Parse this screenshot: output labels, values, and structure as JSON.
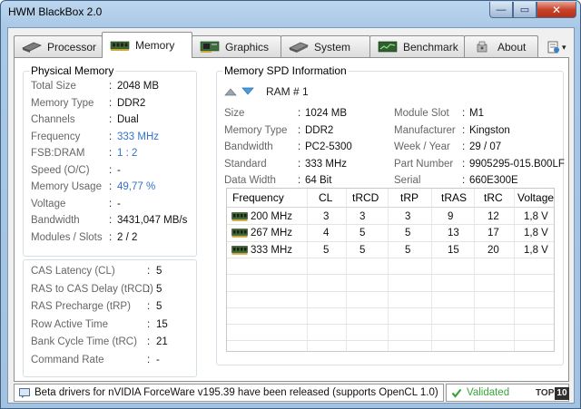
{
  "window": {
    "title": "HWM BlackBox 2.0",
    "min_glyph": "—",
    "max_glyph": "▭",
    "close_glyph": "✕"
  },
  "tabs": [
    {
      "label": "Processor",
      "icon": "cpu-icon"
    },
    {
      "label": "Memory",
      "icon": "memory-icon"
    },
    {
      "label": "Graphics",
      "icon": "graphics-card-icon"
    },
    {
      "label": "System",
      "icon": "system-icon"
    },
    {
      "label": "Benchmark",
      "icon": "benchmark-icon"
    },
    {
      "label": "About",
      "icon": "about-icon"
    }
  ],
  "menu_glyph": "▾",
  "physical_memory": {
    "title": "Physical Memory",
    "rows": [
      {
        "label": "Total Size",
        "value": "2048 MB"
      },
      {
        "label": "Memory Type",
        "value": "DDR2"
      },
      {
        "label": "Channels",
        "value": "Dual"
      },
      {
        "label": "Frequency",
        "value": "333 MHz"
      },
      {
        "label": "FSB:DRAM",
        "value": "1 : 2"
      },
      {
        "label": "Speed (O/C)",
        "value": "-"
      },
      {
        "label": "Memory Usage",
        "value": "49,77 %"
      },
      {
        "label": "Voltage",
        "value": "-"
      },
      {
        "label": "Bandwidth",
        "value": "3431,047 MB/s"
      },
      {
        "label": "Modules / Slots",
        "value": "2  /  2"
      }
    ]
  },
  "timings": {
    "rows": [
      {
        "label": "CAS Latency (CL)",
        "value": "5"
      },
      {
        "label": "RAS to CAS Delay (tRCD)",
        "value": "5"
      },
      {
        "label": "RAS Precharge (tRP)",
        "value": "5"
      },
      {
        "label": "Row Active Time",
        "value": "15"
      },
      {
        "label": "Bank Cycle Time (tRC)",
        "value": "21"
      },
      {
        "label": "Command Rate",
        "value": "-"
      }
    ]
  },
  "spd": {
    "title": "Memory SPD Information",
    "module": "RAM # 1",
    "left": [
      {
        "label": "Size",
        "value": "1024 MB"
      },
      {
        "label": "Memory Type",
        "value": "DDR2"
      },
      {
        "label": "Bandwidth",
        "value": "PC2-5300"
      },
      {
        "label": "Standard",
        "value": "333 MHz"
      },
      {
        "label": "Data Width",
        "value": "64 Bit"
      }
    ],
    "right": [
      {
        "label": "Module Slot",
        "value": "M1"
      },
      {
        "label": "Manufacturer",
        "value": "Kingston"
      },
      {
        "label": "Week / Year",
        "value": "29 / 07"
      },
      {
        "label": "Part Number",
        "value": "9905295-015.B00LF"
      },
      {
        "label": "Serial",
        "value": "660E300E"
      }
    ],
    "table": {
      "headers": [
        "Frequency",
        "CL",
        "tRCD",
        "tRP",
        "tRAS",
        "tRC",
        "Voltage"
      ],
      "rows": [
        [
          "200 MHz",
          "3",
          "3",
          "3",
          "9",
          "12",
          "1,8 V"
        ],
        [
          "267 MHz",
          "4",
          "5",
          "5",
          "13",
          "17",
          "1,8 V"
        ],
        [
          "333 MHz",
          "5",
          "5",
          "5",
          "15",
          "20",
          "1,8 V"
        ]
      ]
    }
  },
  "status": {
    "message": "Beta drivers for nVIDIA ForceWare v195.39 have been released (supports OpenCL 1.0)",
    "validated": "Validated",
    "badge_text": "TOP",
    "badge_num": "10"
  },
  "colors": {
    "accent_blue": "#3173c8",
    "validated_green": "#3aa63a"
  }
}
